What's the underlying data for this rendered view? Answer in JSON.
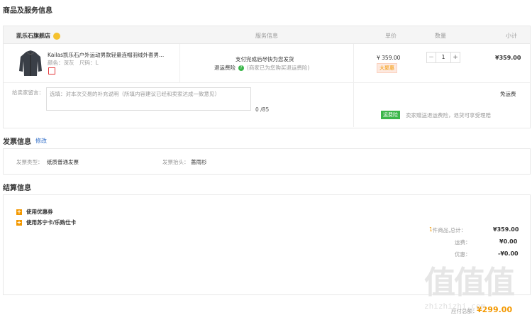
{
  "section_titles": {
    "goods": "商品及服务信息",
    "invoice": "发票信息",
    "settle": "结算信息"
  },
  "goods_table": {
    "store_name": "凯乐石旗舰店",
    "col_service": "服务信息",
    "col_price": "单价",
    "col_qty": "数量",
    "col_subtotal": "小计"
  },
  "product": {
    "title": "Kailas凯乐石户外运动男款轻量连帽羽绒外套男...",
    "attrs": "颜色：深灰　尺码：L",
    "service_line1": "支付完成后尽快为您发货",
    "service_insurance": "退运费险",
    "service_insurance_note": "(商家已为您购买退运费险)",
    "price": "¥ 359.00",
    "promo_tag": "大聚惠",
    "qty_minus": "−",
    "qty_value": "1",
    "qty_plus": "+",
    "subtotal": "¥359.00"
  },
  "message": {
    "label": "给卖家留言：",
    "placeholder": "选填：对本次交易的补充说明（所填内容建议已经和卖家达成一致意见）",
    "counter": "0 /85",
    "shipping": "免运费",
    "insurance_tag": "运费险",
    "insurance_text": "卖家赠送退运费险，退货可享受理赔"
  },
  "invoice": {
    "edit_link": "修改",
    "type_label": "发票类型：",
    "type_value": "纸质普通发票",
    "header_label": "发票抬头：",
    "header_value": "蔷雨杉"
  },
  "settle": {
    "coupon": "使用优惠券",
    "card": "使用苏宁卡/乐购仕卡",
    "count_prefix": "1",
    "count_label": "件商品,总计：",
    "total": "¥359.00",
    "freight_label": "运费：",
    "freight": "¥0.00",
    "discount_label": "优惠：",
    "discount": "-¥0.00",
    "final_label": "应付总额：",
    "final": "¥299.00"
  },
  "watermark": {
    "big": "值值值",
    "url": "zhizhizhi.com"
  },
  "colors": {
    "orange": "#f39800",
    "price_orange": "#e4393c",
    "green": "#3bb64a",
    "link_blue": "#2d6bc7"
  }
}
